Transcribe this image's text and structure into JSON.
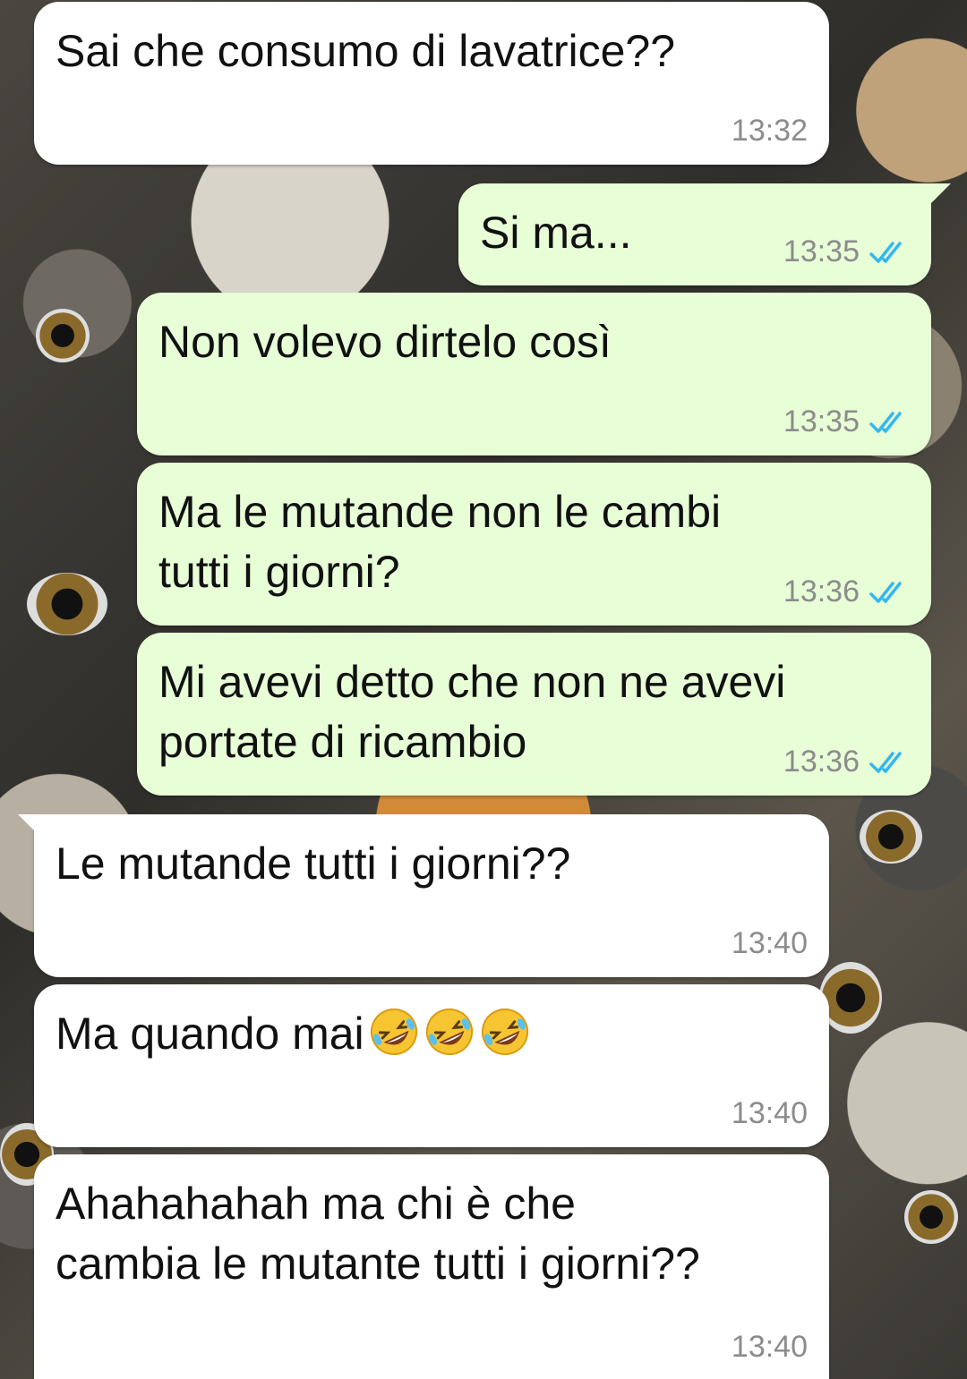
{
  "messages": [
    {
      "direction": "in",
      "text": "Sai che consumo di lavatrice??",
      "time": "13:32"
    },
    {
      "direction": "out",
      "text": "Si ma...",
      "time": "13:35",
      "status": "read-double-check-icon"
    },
    {
      "direction": "out",
      "text": "Non volevo dirtelo così",
      "time": "13:35",
      "status": "read-double-check-icon"
    },
    {
      "direction": "out",
      "text": "Ma le mutande non le cambi\ntutti i giorni?",
      "time": "13:36",
      "status": "read-double-check-icon"
    },
    {
      "direction": "out",
      "text": "Mi avevi detto che non ne avevi\nportate di ricambio",
      "time": "13:36",
      "status": "read-double-check-icon"
    },
    {
      "direction": "in",
      "text": "Le mutande tutti i giorni??",
      "time": "13:40"
    },
    {
      "direction": "in",
      "text": "Ma quando mai",
      "emojis": [
        "rolling-on-floor-laughing-emoji",
        "rolling-on-floor-laughing-emoji",
        "rolling-on-floor-laughing-emoji"
      ],
      "time": "13:40"
    },
    {
      "direction": "in",
      "text": "Ahahahahah ma chi è che\ncambia le mutante tutti i giorni??",
      "time": "13:40"
    }
  ],
  "colors": {
    "incoming_bubble": "#ffffff",
    "outgoing_bubble": "#e7fed7",
    "read_ticks": "#34b7f1",
    "timestamp": "#8c8c8c"
  },
  "wallpaper": "illustrated-cats-wallpaper"
}
